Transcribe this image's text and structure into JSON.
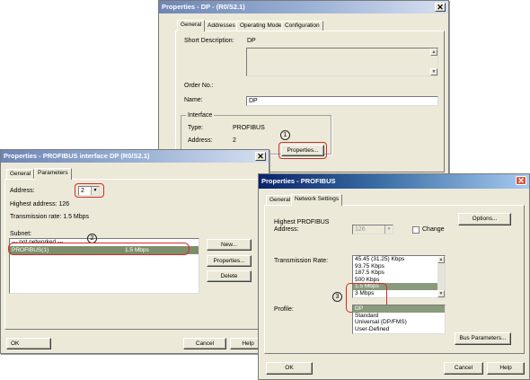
{
  "win_dp": {
    "title": "Properties - DP - (R0/S2.1)",
    "tabs": [
      "General",
      "Addresses",
      "Operating Mode",
      "Configuration"
    ],
    "short_description_label": "Short Description:",
    "short_description_value": "DP",
    "order_no_label": "Order No.:",
    "name_label": "Name:",
    "name_value": "DP",
    "interface_group": "Interface",
    "type_label": "Type:",
    "type_value": "PROFIBUS",
    "address_label": "Address:",
    "address_value": "2",
    "properties_button": "Properties...",
    "circle": "1"
  },
  "win_iface": {
    "title": "Properties - PROFIBUS interface  DP (R0/S2.1)",
    "tabs": [
      "General",
      "Parameters"
    ],
    "address_label": "Address:",
    "address_value": "2",
    "highest_address": "Highest address: 126",
    "transmission_rate": "Transmission rate: 1.5 Mbps",
    "subnet_label": "Subnet:",
    "subnet_rows": [
      {
        "name": "--- not networked ---",
        "rate": ""
      },
      {
        "name": "PROFIBUS(1)",
        "rate": "1.5 Mbps"
      }
    ],
    "new_button": "New...",
    "properties_button": "Properties...",
    "delete_button": "Delete",
    "ok_button": "OK",
    "cancel_button": "Cancel",
    "help_button": "Help",
    "circle": "2"
  },
  "win_profibus": {
    "title": "Properties - PROFIBUS",
    "tabs": [
      "General",
      "Network Settings"
    ],
    "highest_address_label": "Highest PROFIBUS Address:",
    "highest_address_value": "126",
    "change_label": "Change",
    "options_button": "Options...",
    "transmission_rate_label": "Transmission Rate:",
    "rates": [
      "45.45 (31.25) Kbps",
      "93.75 Kbps",
      "187.5 Kbps",
      "500 Kbps",
      "1.5 Mbps",
      "3 Mbps"
    ],
    "selected_rate": "1.5 Mbps",
    "profile_label": "Profile:",
    "profiles": [
      "DP",
      "Standard",
      "Universal (DP/FMS)",
      "User-Defined"
    ],
    "selected_profile": "DP",
    "bus_parameters_button": "Bus Parameters...",
    "ok_button": "OK",
    "cancel_button": "Cancel",
    "help_button": "Help",
    "circle": "3"
  },
  "colors": {
    "annotation": "#d42a2a",
    "title_active": "#0a246a",
    "selection": "#7e8e6a"
  }
}
